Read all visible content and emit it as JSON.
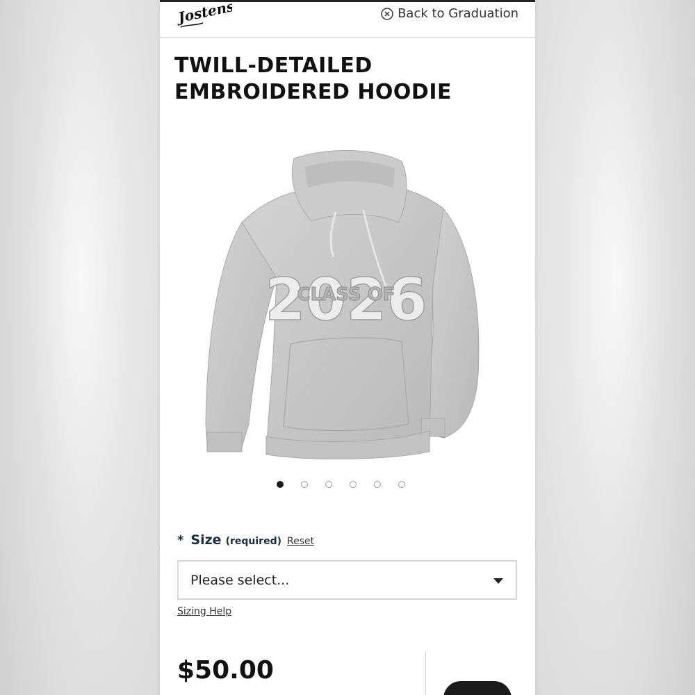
{
  "header": {
    "logo_text": "Jostens",
    "back_link": "Back to Graduation"
  },
  "product": {
    "title_line1": "TWILL-DETAILED",
    "title_line2": "EMBROIDERED HOODIE",
    "image_icon": "hoodie-product-image",
    "print_text": "CLASS OF",
    "print_year": "2026",
    "carousel": {
      "count": 6,
      "active_index": 0
    }
  },
  "options": {
    "size": {
      "asterisk": "*",
      "label": "Size",
      "required": "(required)",
      "reset": "Reset",
      "placeholder": "Please select...",
      "help": "Sizing Help"
    }
  },
  "pricing": {
    "price": "$50.00"
  },
  "colors": {
    "title": "#111111",
    "label_navy": "#1c2d3d",
    "hoodie_gray": "#c6c6c6",
    "button_dark": "#1a1a1a"
  }
}
